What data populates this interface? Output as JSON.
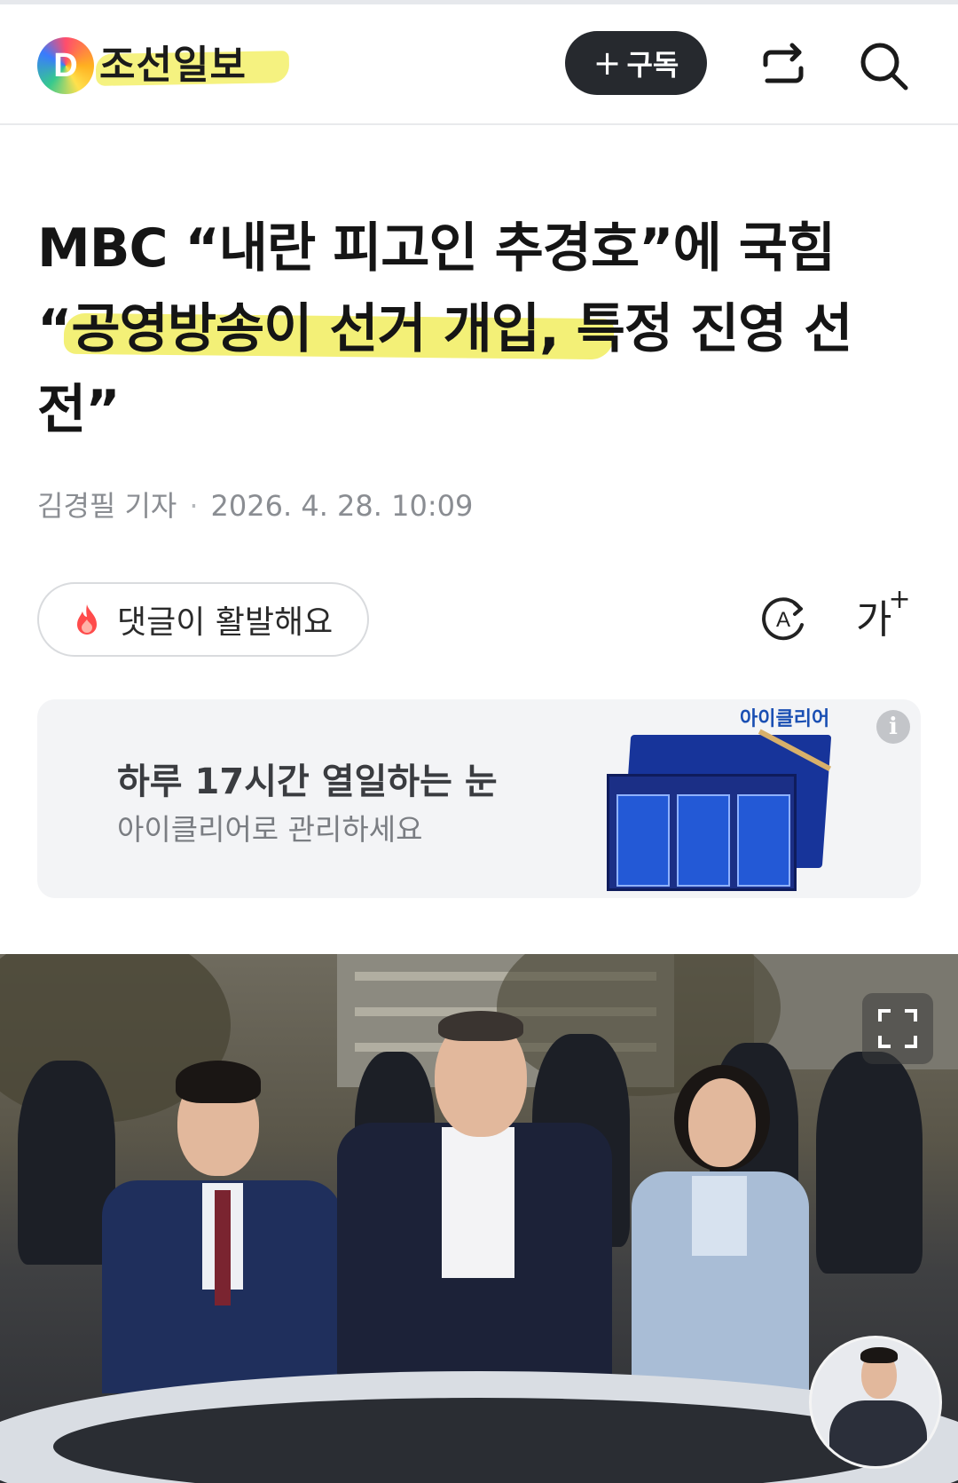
{
  "header": {
    "logo_letter": "D",
    "brand": "조선일보",
    "subscribe_plus": "+",
    "subscribe_label": "구독",
    "share_icon": "share-icon",
    "search_icon": "search-icon"
  },
  "article": {
    "headline_lines": [
      "MBC “내란 피고인 추경호”에 국힘",
      "“공영방송이 선거 개입, 특정 진영 선",
      "전”"
    ],
    "author": "김경필 기자",
    "separator": "·",
    "datetime": "2026. 4. 28. 10:09"
  },
  "actions": {
    "comment_label": "댓글이 활발해요",
    "font_label": "가",
    "font_plus": "+"
  },
  "ad": {
    "brand": "아이클리어",
    "title": "하루 17시간 열일하는 눈",
    "subtitle": "아이클리어로 관리하세요",
    "info": "i"
  },
  "colors": {
    "highlight": "#f0ec55",
    "subscribe_bg": "#26292e",
    "byline": "#8a8d92"
  }
}
